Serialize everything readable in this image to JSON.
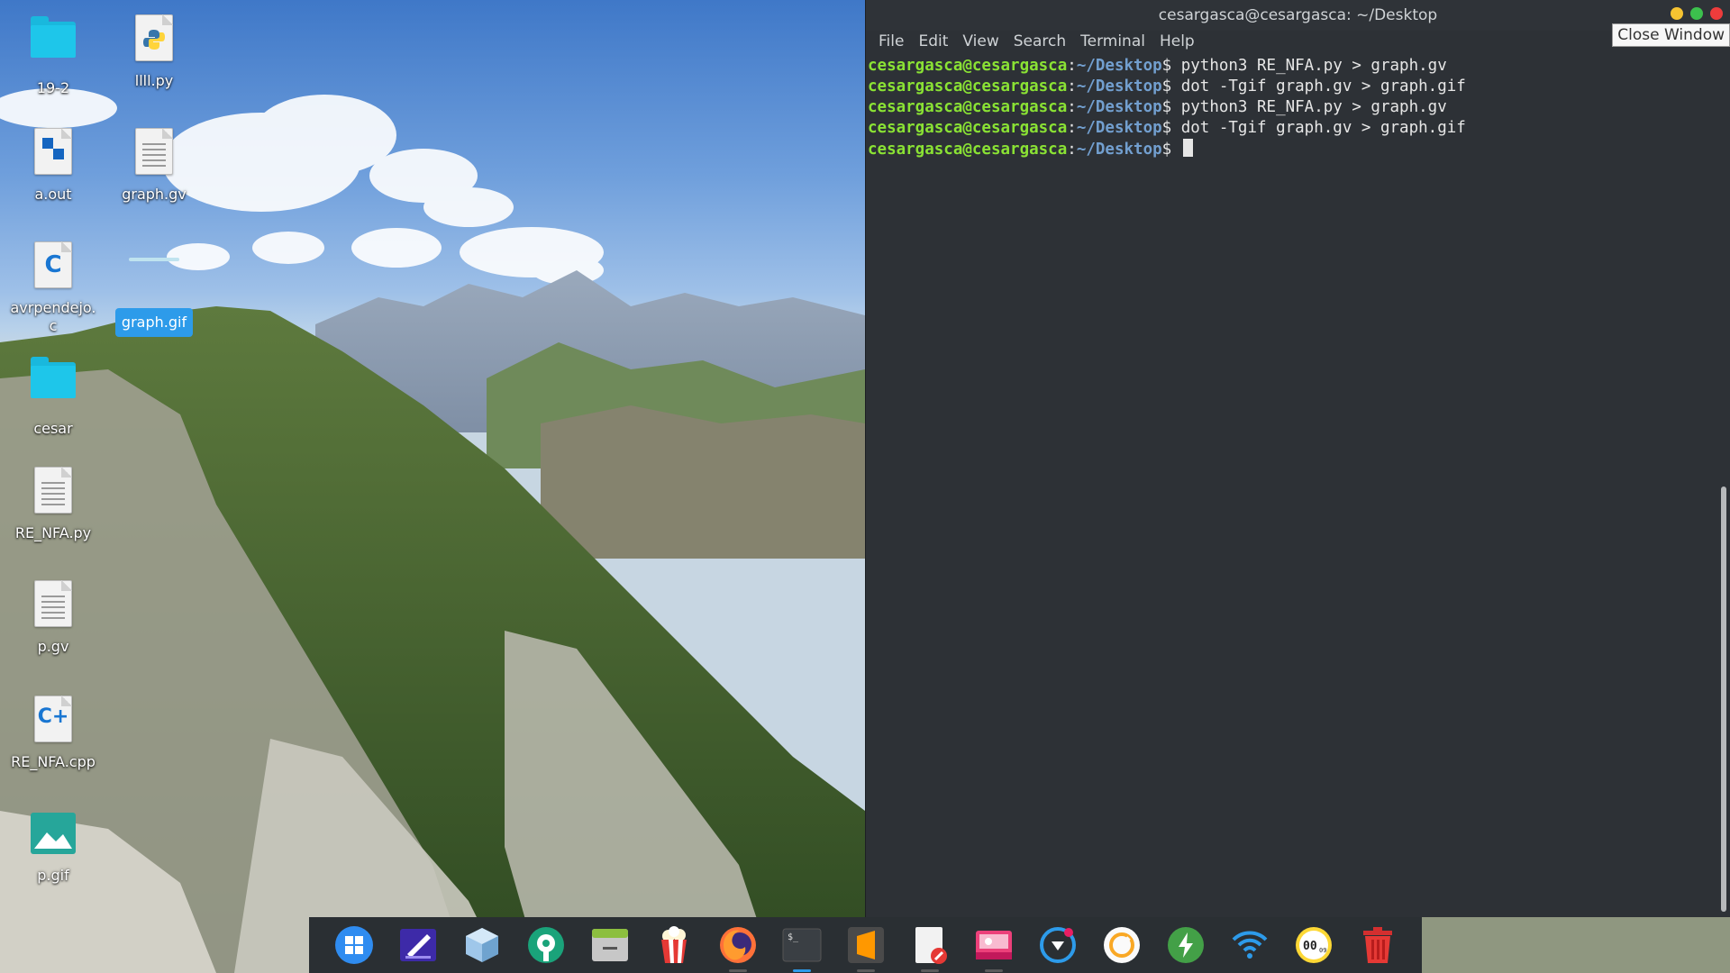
{
  "desktop": {
    "icons": [
      {
        "label": "19-2",
        "icon": "folder-icon"
      },
      {
        "label": "llll.py",
        "icon": "python-file-icon"
      },
      {
        "label": "a.out",
        "icon": "executable-icon"
      },
      {
        "label": "graph.gv",
        "icon": "text-file-icon"
      },
      {
        "label": "avrpendejo.c",
        "icon": "c-file-icon"
      },
      {
        "label": "graph.gif",
        "icon": "image-file-icon"
      },
      {
        "label": "cesar",
        "icon": "folder-icon"
      },
      {
        "label": "RE_NFA.py",
        "icon": "text-file-icon"
      },
      {
        "label": "p.gv",
        "icon": "text-file-icon"
      },
      {
        "label": "RE_NFA.cpp",
        "icon": "cpp-file-icon"
      },
      {
        "label": "p.gif",
        "icon": "image-file-icon"
      }
    ]
  },
  "terminal": {
    "title": "cesargasca@cesargasca: ~/Desktop",
    "menu": [
      "File",
      "Edit",
      "View",
      "Search",
      "Terminal",
      "Help"
    ],
    "tooltip": "Close Window",
    "prompt_user": "cesargasca@cesargasca",
    "prompt_path": "~/Desktop",
    "lines": [
      "python3 RE_NFA.py > graph.gv",
      "dot -Tgif graph.gv > graph.gif",
      "python3 RE_NFA.py > graph.gv",
      "dot -Tgif graph.gv > graph.gif",
      ""
    ]
  },
  "colors": {
    "prompt_user": "#8ae234",
    "prompt_path": "#729fcf",
    "terminal_bg": "#2d3136",
    "selection": "#2d9bea"
  },
  "dock": {
    "items": [
      "app-launcher-icon",
      "text-editor-icon",
      "package-manager-icon",
      "settings-icon",
      "file-manager-icon",
      "popcorn-time-icon",
      "firefox-icon",
      "terminal-icon",
      "sublime-text-icon",
      "document-editor-icon",
      "image-viewer-icon",
      "location-icon",
      "power-manager-icon",
      "battery-icon",
      "wifi-icon",
      "clock-icon",
      "trash-icon"
    ]
  }
}
